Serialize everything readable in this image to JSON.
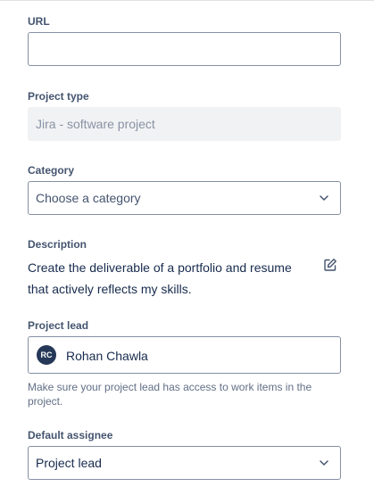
{
  "fields": {
    "url": {
      "label": "URL",
      "value": "",
      "placeholder": ""
    },
    "project_type": {
      "label": "Project type",
      "value": "Jira - software project"
    },
    "category": {
      "label": "Category",
      "placeholder": "Choose a category"
    },
    "description": {
      "label": "Description",
      "text": "Create the deliverable of a portfolio and resume that actively reflects my skills."
    },
    "project_lead": {
      "label": "Project lead",
      "avatar_initials": "RC",
      "name": "Rohan Chawla",
      "helper": "Make sure your project lead has access to work items in the project."
    },
    "default_assignee": {
      "label": "Default assignee",
      "value": "Project lead"
    }
  },
  "icons": {
    "chevron": "chevron-down-icon",
    "edit": "edit-icon"
  },
  "colors": {
    "text": "#172b4d",
    "label": "#44546f",
    "border": "#8590a2",
    "disabled_bg": "#f1f2f4",
    "avatar_bg": "#253858"
  }
}
